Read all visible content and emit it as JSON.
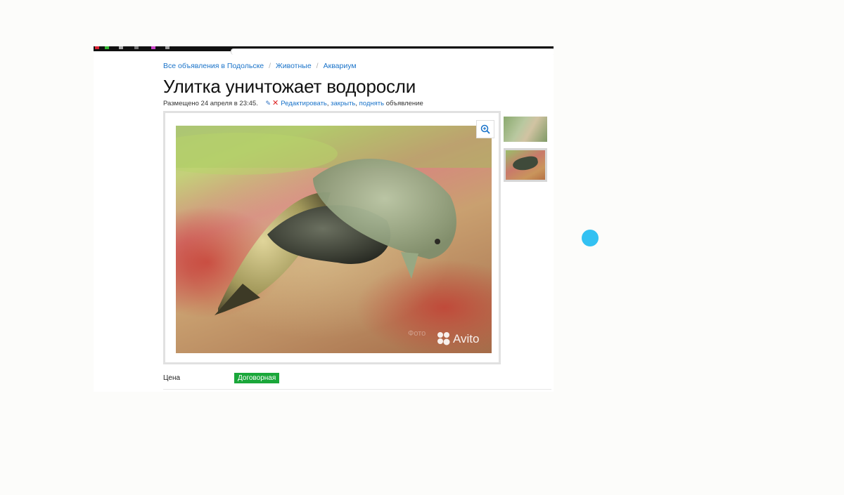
{
  "breadcrumb": {
    "items": [
      "Все объявления в Подольске",
      "Животные",
      "Аквариум"
    ],
    "separator": "/"
  },
  "listing": {
    "title": "Улитка уничтожает водоросли",
    "posted": "Размещено 24 апреля в 23:45.",
    "actions": {
      "edit": "Редактировать",
      "close": "закрыть",
      "raise": "поднять",
      "suffix": "объявление"
    }
  },
  "gallery": {
    "watermark_text": "Фото",
    "watermark_brand": "Avito",
    "thumbnail_count": 2,
    "selected_thumbnail": 2
  },
  "price": {
    "label": "Цена",
    "value": "Договорная"
  },
  "colors": {
    "link": "#1a73c9",
    "price_badge": "#1aa73a",
    "delete_icon": "#d22222",
    "cursor_dot": "#33c1f2"
  },
  "icons": [
    "pencil-icon",
    "delete-x-icon",
    "zoom-in-icon",
    "avito-logo-icon"
  ]
}
